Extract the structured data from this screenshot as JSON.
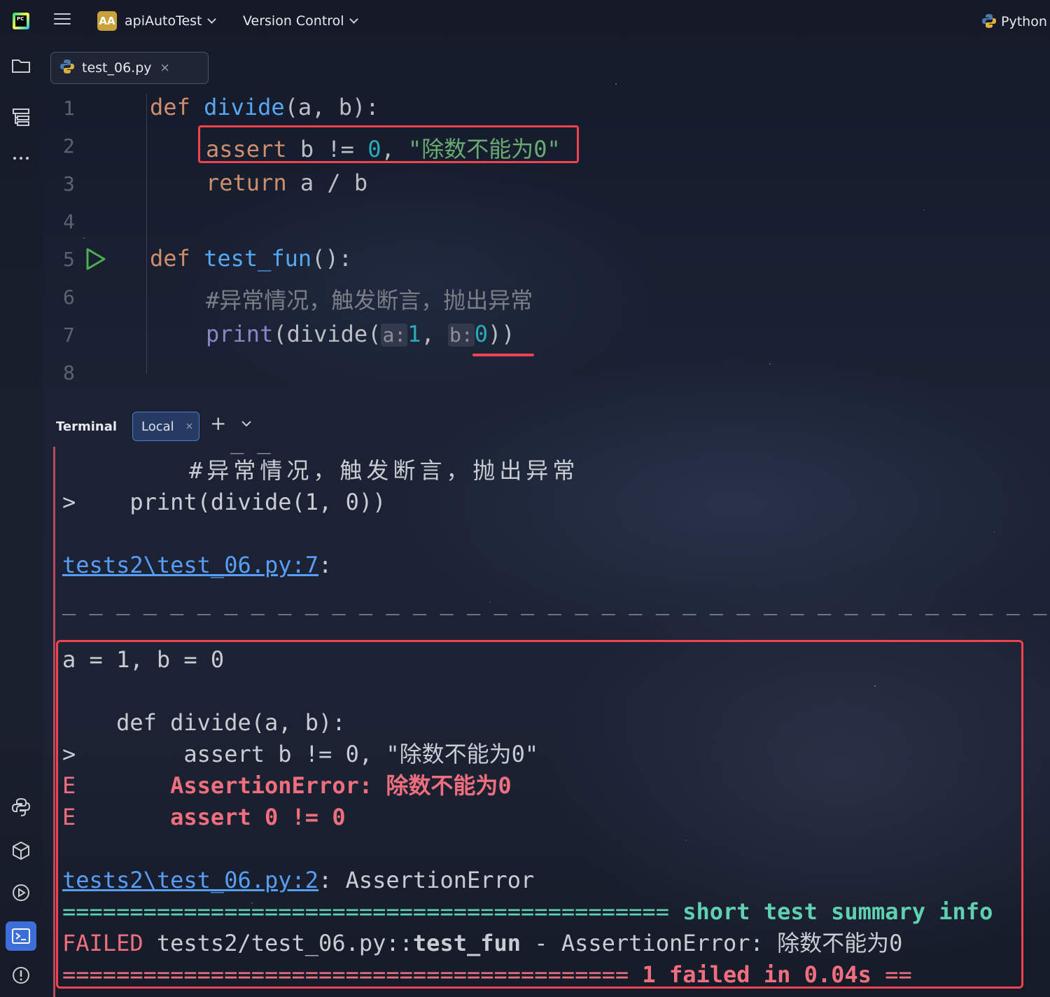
{
  "topbar": {
    "project_badge": "AA",
    "project_name": "apiAutoTest",
    "vc_menu": "Version Control",
    "interpreter": "Python"
  },
  "tabs": [
    {
      "label": "test_06.py",
      "close": "×"
    }
  ],
  "editor": {
    "lines": [
      {
        "n": "1"
      },
      {
        "n": "2"
      },
      {
        "n": "3"
      },
      {
        "n": "4"
      },
      {
        "n": "5"
      },
      {
        "n": "6"
      },
      {
        "n": "7"
      },
      {
        "n": "8"
      }
    ],
    "code": {
      "l1_kw": "def",
      "l1_fn": "divide",
      "l1_rest": "(a, b):",
      "l2_kw": "assert",
      "l2_mid": " b != ",
      "l2_num": "0",
      "l2_comma": ", ",
      "l2_str": "\"除数不能为0\"",
      "l3_kw": "return",
      "l3_rest": " a / b",
      "l5_kw": "def",
      "l5_fn": "test_fun",
      "l5_rest": "():",
      "l6_cmt": "#异常情况，触发断言，抛出异常",
      "l7_builtin": "print",
      "l7_a": "(divide(",
      "l7_hint_a": "a:",
      "l7_num1": "1",
      "l7_comma": ", ",
      "l7_hint_b": "b:",
      "l7_num2": "0",
      "l7_close": "))"
    }
  },
  "terminal": {
    "title": "Terminal",
    "tab_label": "Local",
    "tab_close": "×",
    "add": "+",
    "output": {
      "partial": "_ _",
      "cmt": "    #异常情况，触发断言，抛出异常",
      "print_prefix": ">",
      "print_code": "    print(divide(1, 0))",
      "loc1_link": "tests2\\test_06.py",
      "loc1_num": ":7",
      "loc1_colon": ":",
      "dashes": "_ _ _ _ _ _ _ _ _ _ _ _ _ _ _ _ _ _ _ _ _ _ _ _ _ _ _ _ _ _ _ _ _ _ _ _ _ _",
      "args": "a = 1, b = 0",
      "def_line": "    def divide(a, b):",
      "assert_prefix": ">",
      "assert_line": "        assert b != 0, \"除数不能为0\"",
      "e1_prefix": "E",
      "e1_text": "       AssertionError: 除数不能为0",
      "e2_prefix": "E",
      "e2_text": "       assert 0 != 0",
      "loc2_link": "tests2\\test_06.py",
      "loc2_num": ":2",
      "loc2_rest": ": AssertionError",
      "sep1_eq": "=============================================",
      "sep1_text": " short test summary info",
      "failed_word": "FAILED",
      "failed_path": " tests2/test_06.py::",
      "failed_fn": "test_fun",
      "failed_rest": " - AssertionError: 除数不能为0",
      "sep2_eq": "==========================================",
      "sep2_text": " 1 failed in 0.04s ",
      "sep2_tail": "=="
    }
  }
}
